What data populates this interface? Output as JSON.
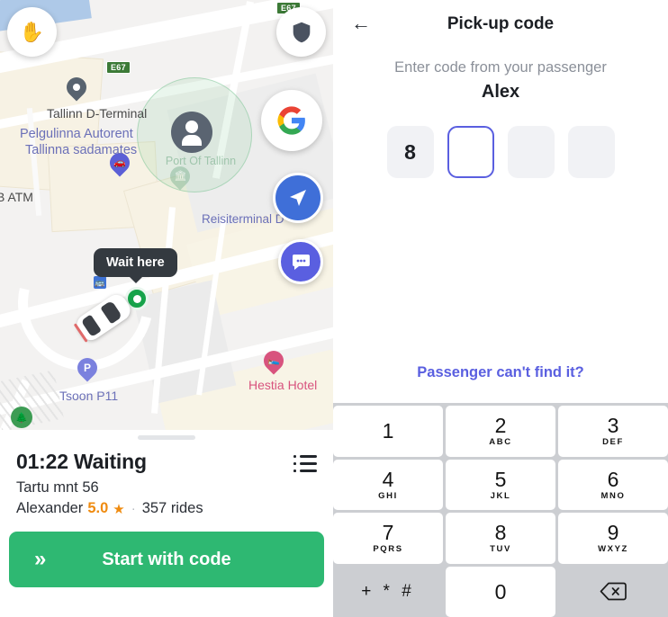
{
  "map": {
    "labels": {
      "d_terminal": "Tallinn D-Terminal",
      "pelgulinna": "Pelgulinna Autorent",
      "sadamates": "Tallinna sadamates",
      "atm": "B ATM",
      "reisiterminal": "Reisiterminal D",
      "tsoon": "Tsoon P11",
      "hestia": "Hestia Hotel",
      "zone": "Port Of Tallinn"
    },
    "highway_shield_1": "E67",
    "highway_shield_2": "E67",
    "tooltip": "Wait here",
    "fabs": {
      "hand": "hand-pan-icon",
      "shield": "safety-shield-icon",
      "google": "google-logo-icon",
      "navigate": "navigate-arrow-icon",
      "chat": "chat-bubble-icon"
    }
  },
  "sheet": {
    "timer": "01:22",
    "status": "Waiting",
    "title": "01:22 Waiting",
    "address": "Tartu mnt 56",
    "passenger_name": "Alexander",
    "rating": "5.0",
    "star": "★",
    "separator": "·",
    "rides": "357 rides",
    "start_button": "Start with code",
    "chevrons": "»",
    "list_icon": "order-details-list-icon"
  },
  "pickup": {
    "back_icon": "back-arrow-icon",
    "title": "Pick-up code",
    "instruction": "Enter code from your passenger",
    "passenger": "Alex",
    "code_digits": [
      "8",
      "",
      "",
      ""
    ],
    "active_index": 1,
    "cant_find": "Passenger can't find it?"
  },
  "keypad": {
    "keys": [
      {
        "num": "1",
        "sub": ""
      },
      {
        "num": "2",
        "sub": "ABC"
      },
      {
        "num": "3",
        "sub": "DEF"
      },
      {
        "num": "4",
        "sub": "GHI"
      },
      {
        "num": "5",
        "sub": "JKL"
      },
      {
        "num": "6",
        "sub": "MNO"
      },
      {
        "num": "7",
        "sub": "PQRS"
      },
      {
        "num": "8",
        "sub": "TUV"
      },
      {
        "num": "9",
        "sub": "WXYZ"
      },
      {
        "num": "+ * #",
        "sub": ""
      },
      {
        "num": "0",
        "sub": ""
      },
      {
        "num": "backspace-icon",
        "sub": ""
      }
    ],
    "symbols_key": "+ * #",
    "zero_key": "0",
    "backspace_label": "backspace-icon"
  },
  "colors": {
    "accent_green": "#2eb872",
    "accent_indigo": "#5a5fe0",
    "rating_orange": "#ef8b10",
    "hotel_pink": "#d8537e",
    "nav_blue": "#3f6fd8"
  }
}
